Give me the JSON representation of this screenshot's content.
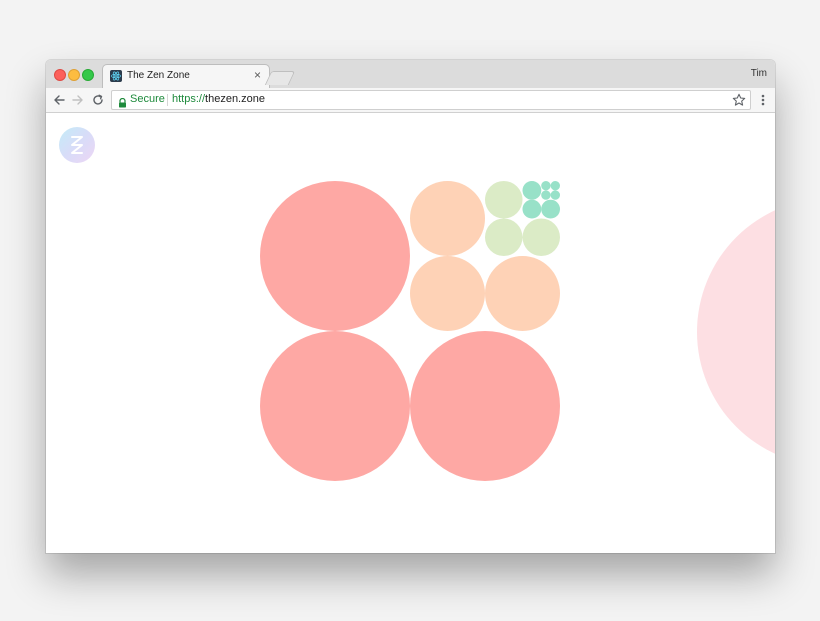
{
  "window": {
    "profile_name": "Tim"
  },
  "tab": {
    "title": "The Zen Zone",
    "close_glyph": "×",
    "favicon": "react-atom-icon"
  },
  "address_bar": {
    "secure_label": "Secure",
    "url_scheme": "https://",
    "url_host": "thezen.zone"
  },
  "icons": {
    "back": "arrow-left-icon",
    "forward": "arrow-right-icon",
    "reload": "reload-icon",
    "lock": "lock-icon",
    "bookmark": "star-icon",
    "menu": "kebab-menu-icon"
  },
  "app": {
    "logo": "zen-zone-logo-icon"
  },
  "colors": {
    "coral": "#fea8a4",
    "peach": "#fed2b6",
    "sage": "#dbebc6",
    "mint": "#98e1c8",
    "pink": "#fddfe3",
    "secure_green": "#1e8a3c"
  }
}
